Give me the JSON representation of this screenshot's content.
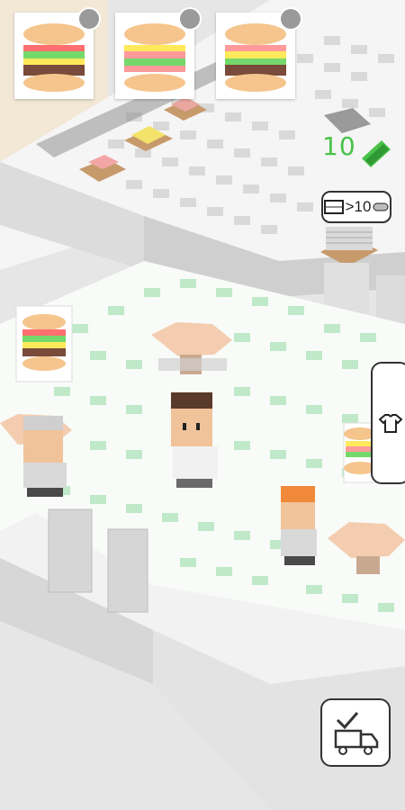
{
  "hud": {
    "orders": [
      {
        "item": "burger-stack-grill"
      },
      {
        "item": "burger-stack-salad"
      },
      {
        "item": "burger-stack-meat"
      }
    ],
    "money": {
      "value": "10",
      "icon": "cash-icon",
      "color": "#49c24a"
    },
    "sandwich_requirement": {
      "icon": "film-icon",
      "text": ">10",
      "trail_icon": "pill-icon"
    },
    "side_tab_icon": "shirt-icon",
    "delivery_icon": "truck-check-icon"
  },
  "colors": {
    "floor_tile": "#bfe9c8",
    "wall": "#f4f4f4",
    "table": "#f4cdb0"
  }
}
